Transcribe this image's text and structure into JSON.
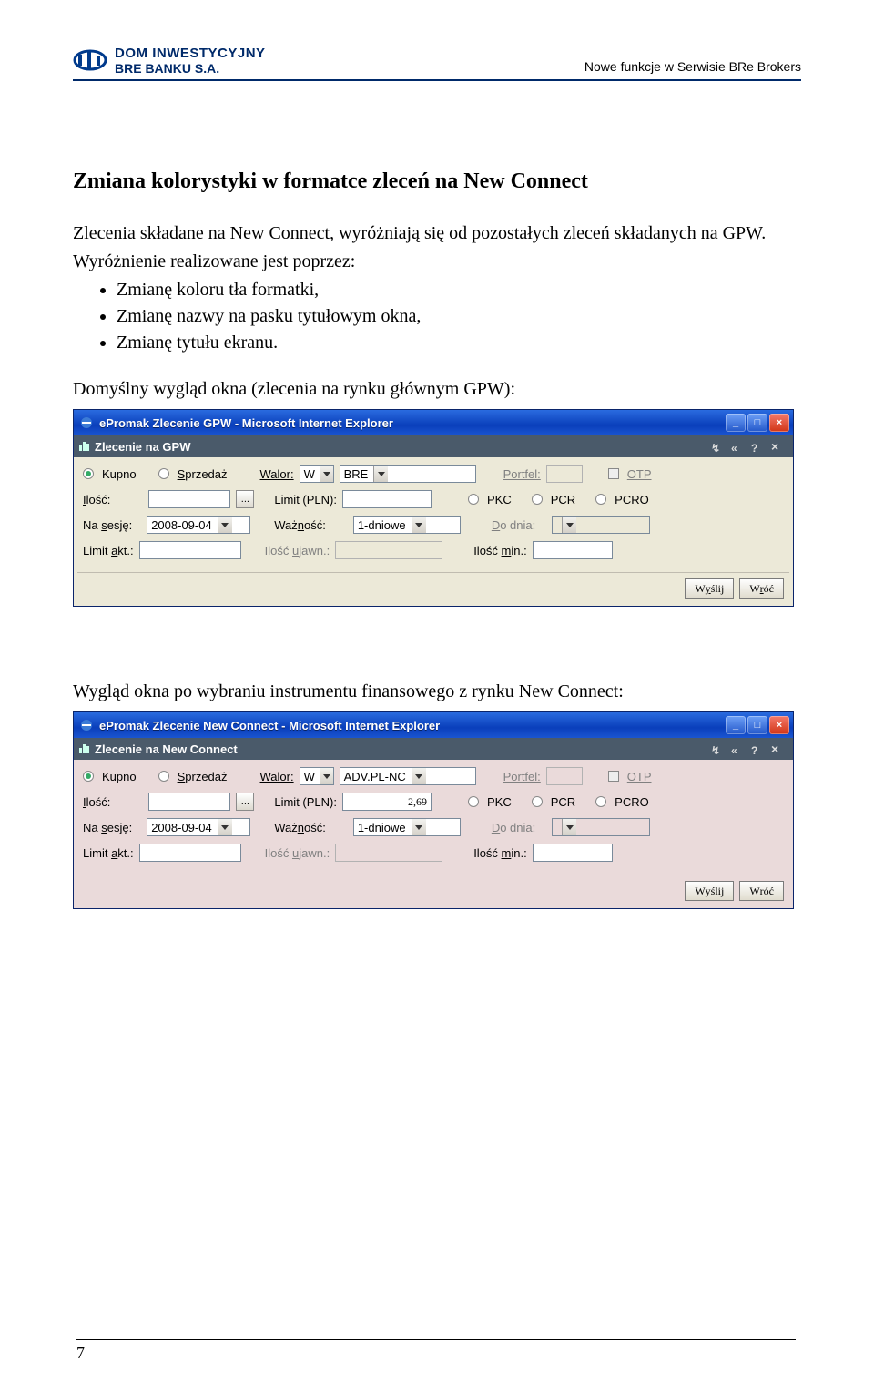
{
  "header": {
    "logo_line1_a": "D",
    "logo_line1_b": "OM ",
    "logo_line1_c": "I",
    "logo_line1_d": "NWESTYCYJNY",
    "logo_line2": "BRE BANKU S.A.",
    "right_text": "Nowe funkcje w Serwisie BRe Brokers"
  },
  "body": {
    "heading": "Zmiana kolorystyki w formatce zleceń na New Connect",
    "para1": "Zlecenia składane na New Connect, wyróżniają się od pozostałych zleceń składanych na GPW.",
    "para2": "Wyróżnienie realizowane jest poprzez:",
    "bullets": [
      "Zmianę koloru tła formatki,",
      "Zmianę nazwy na pasku tytułowym okna,",
      "Zmianę tytułu ekranu."
    ],
    "caption1": "Domyślny wygląd okna (zlecenia na rynku głównym GPW):",
    "caption2": "Wygląd okna po wybraniu instrumentu finansowego z rynku New Connect:"
  },
  "labels": {
    "kupno": "Kupno",
    "sprzedaz_pre": "S",
    "sprzedaz_post": "przedaż",
    "walor": "Walor:",
    "walor_w": "W",
    "portfel": "Portfel:",
    "otp": "OTP",
    "ilosc_pre": "I",
    "ilosc_post": "lość:",
    "limit": "Limit (PLN):",
    "pkc": "PKC",
    "pcr": "PCR",
    "pcro": "PCRO",
    "na_sesje_pre": "Na ",
    "na_sesje_u": "s",
    "na_sesje_post": "esję:",
    "waznosc_pre": "Waż",
    "waznosc_u": "n",
    "waznosc_post": "ość:",
    "do_dnia_pre": "D",
    "do_dnia_post": "o dnia:",
    "limit_akt_pre": "Limit ",
    "limit_akt_u": "a",
    "limit_akt_post": "kt.:",
    "ilosc_ujawn_pre": "Ilość ",
    "ilosc_ujawn_u": "u",
    "ilosc_ujawn_post": "jawn.:",
    "ilosc_min_pre": "Ilość ",
    "ilosc_min_u": "m",
    "ilosc_min_post": "in.:",
    "wyslij_pre": "W",
    "wyslij_u": "y",
    "wyslij_post": "ślij",
    "wroc_pre": "W",
    "wroc_u": "r",
    "wroc_post": "óć",
    "dots": "..."
  },
  "win1": {
    "title": "ePromak Zlecenie GPW - Microsoft Internet Explorer",
    "subtitle": "Zlecenie na GPW",
    "walor_value": "BRE",
    "limit_value": "",
    "date": "2008-09-04",
    "waznosc": "1-dniowe"
  },
  "win2": {
    "title": "ePromak Zlecenie New Connect - Microsoft Internet Explorer",
    "subtitle": "Zlecenie na New Connect",
    "walor_value": "ADV.PL-NC",
    "limit_value": "2,69",
    "date": "2008-09-04",
    "waznosc": "1-dniowe"
  },
  "page_number": "7"
}
